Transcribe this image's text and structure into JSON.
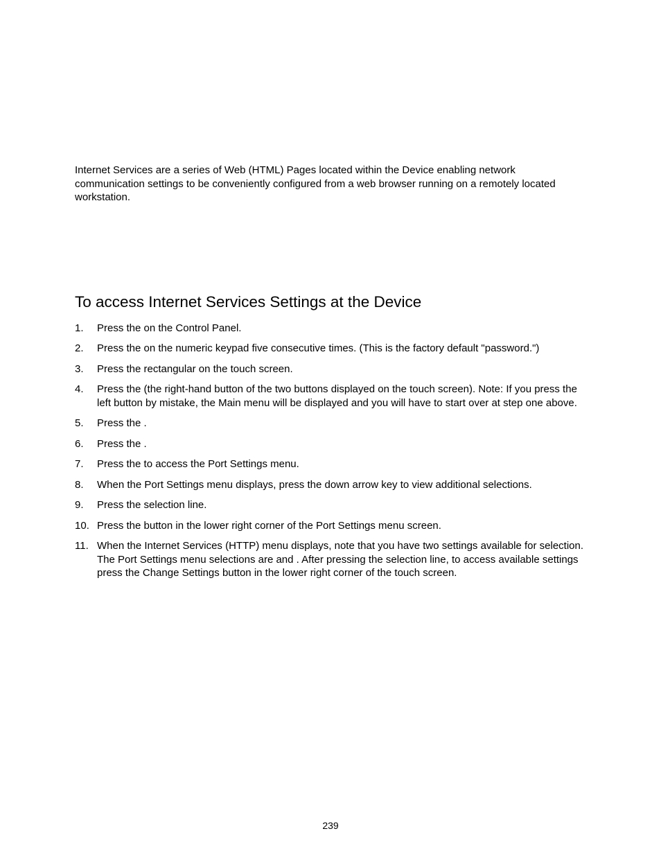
{
  "intro": "Internet Services are a series of Web (HTML) Pages located within the Device enabling network communication settings to be conveniently configured from a web browser running on a remotely located workstation.",
  "heading": "To access Internet Services Settings at the Device",
  "items": [
    "Press the                                      on the Control Panel.",
    "Press the               on the numeric keypad five consecutive times.  (This is the factory default \"password.\")",
    "Press the rectangular                             on the touch screen.",
    "Press the                                         (the right-hand button of the two buttons displayed on the touch screen).  Note:  If you press the left button by mistake, the Main menu will be displayed and you will have to start over at step one above.",
    "Press the                                             .",
    "Press the                                             .",
    "Press the                                       to access the Port Settings menu.",
    "When the Port Settings menu displays, press the down arrow key to view additional selections.",
    "Press the                                            selection line.",
    "Press the                                 button in the lower right corner of the Port Settings menu screen.",
    "When the Internet Services (HTTP) menu displays, note that you have two settings available for selection.  The Port Settings menu selections are                          and                                                       .  After pressing the selection line, to access available settings press the Change Settings button in the lower right corner of the touch screen."
  ],
  "pageNumber": "239"
}
